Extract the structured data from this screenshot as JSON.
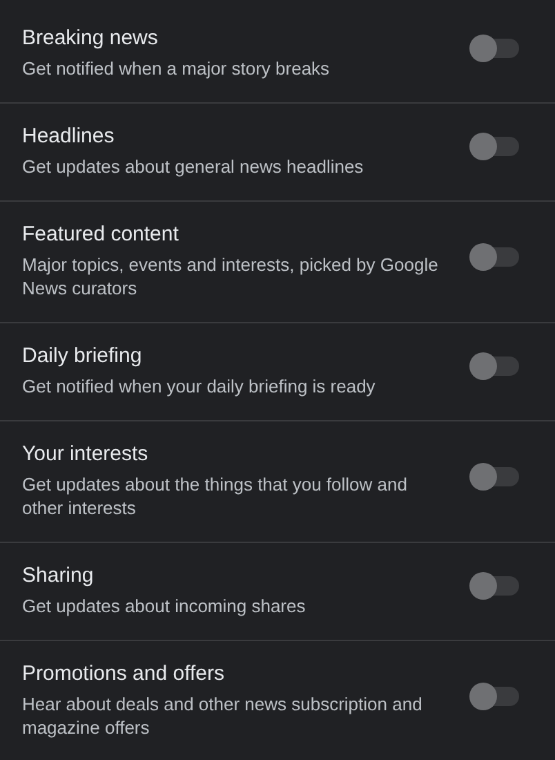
{
  "settings": [
    {
      "title": "Breaking news",
      "description": "Get notified when a major story breaks",
      "on": false
    },
    {
      "title": "Headlines",
      "description": "Get updates about general news headlines",
      "on": false
    },
    {
      "title": "Featured content",
      "description": "Major topics, events and interests, picked by Google News curators",
      "on": false
    },
    {
      "title": "Daily briefing",
      "description": "Get notified when your daily briefing is ready",
      "on": false
    },
    {
      "title": "Your interests",
      "description": "Get updates about the things that you follow and other interests",
      "on": false
    },
    {
      "title": "Sharing",
      "description": "Get updates about incoming shares",
      "on": false
    },
    {
      "title": "Promotions and offers",
      "description": "Hear about deals and other news subscription and magazine offers",
      "on": false
    }
  ]
}
